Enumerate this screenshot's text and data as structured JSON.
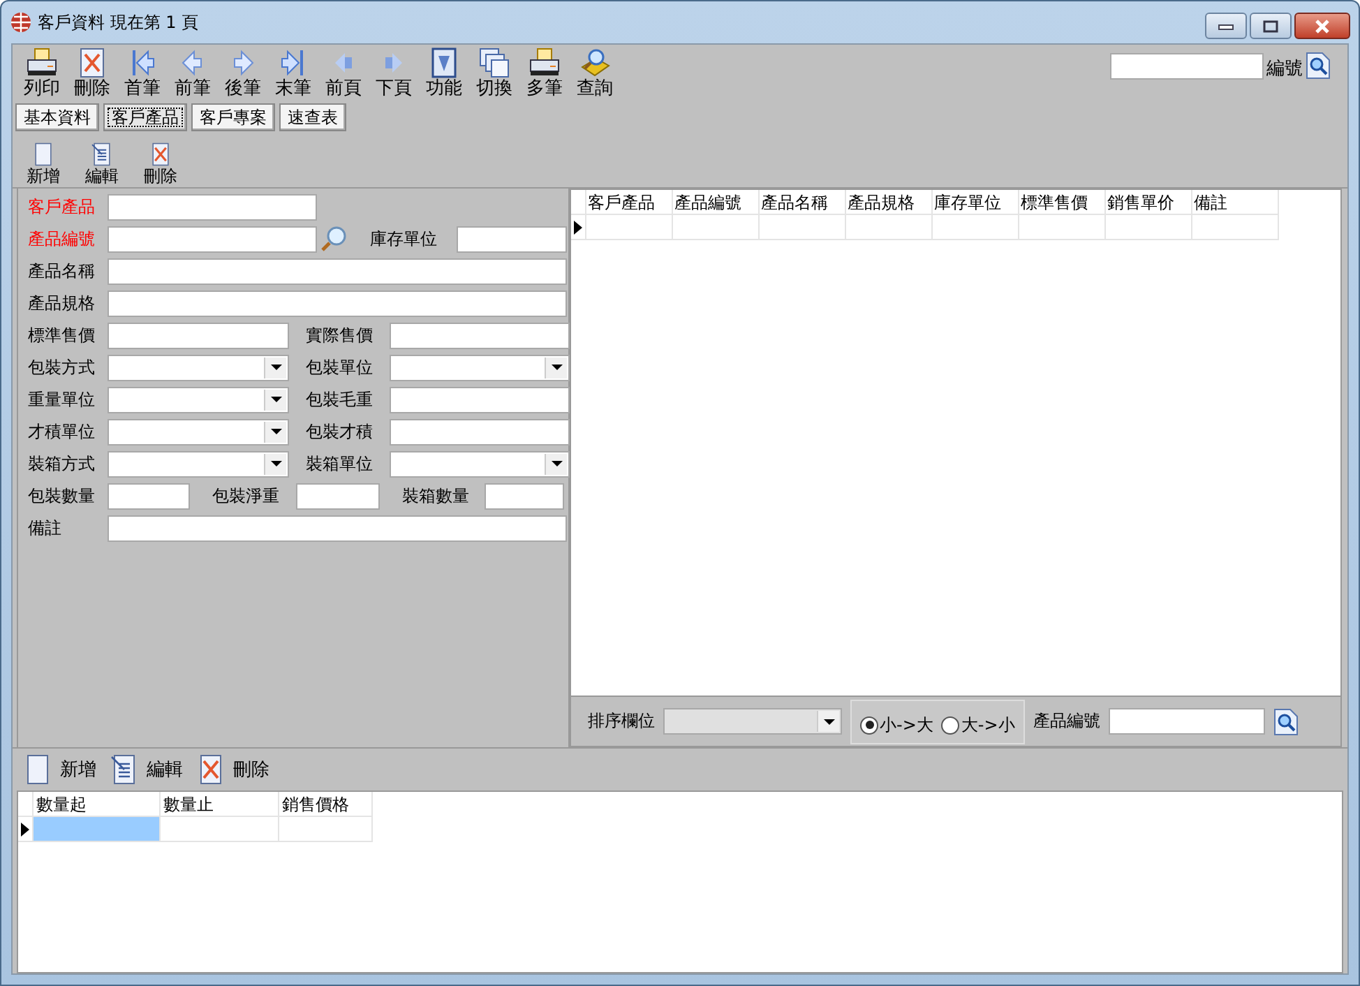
{
  "window": {
    "title": "客戶資料 現在第 1 頁"
  },
  "toolbar": [
    {
      "label": "列印"
    },
    {
      "label": "刪除"
    },
    {
      "label": "首筆"
    },
    {
      "label": "前筆"
    },
    {
      "label": "後筆"
    },
    {
      "label": "末筆"
    },
    {
      "label": "前頁"
    },
    {
      "label": "下頁"
    },
    {
      "label": "功能"
    },
    {
      "label": "切換"
    },
    {
      "label": "多筆"
    },
    {
      "label": "查詢"
    }
  ],
  "search": {
    "label": "編號"
  },
  "tabs": [
    {
      "label": "基本資料",
      "selected": false
    },
    {
      "label": "客戶產品",
      "selected": true
    },
    {
      "label": "客戶專案",
      "selected": false
    },
    {
      "label": "速查表",
      "selected": false
    }
  ],
  "subtoolbar": [
    {
      "label": "新增"
    },
    {
      "label": "編輯"
    },
    {
      "label": "刪除"
    }
  ],
  "form": {
    "rows": [
      {
        "fields": [
          {
            "label": "客戶產品",
            "required": true,
            "kind": "text"
          }
        ]
      },
      {
        "fields": [
          {
            "label": "產品編號",
            "required": true,
            "kind": "text"
          },
          {
            "label": "庫存單位",
            "required": false,
            "kind": "text"
          }
        ]
      },
      {
        "fields": [
          {
            "label": "產品名稱",
            "required": false,
            "kind": "text"
          }
        ]
      },
      {
        "fields": [
          {
            "label": "產品規格",
            "required": false,
            "kind": "text"
          }
        ]
      },
      {
        "fields": [
          {
            "label": "標準售價",
            "required": false,
            "kind": "text"
          },
          {
            "label": "實際售價",
            "required": false,
            "kind": "text"
          }
        ]
      },
      {
        "fields": [
          {
            "label": "包裝方式",
            "required": false,
            "kind": "combo"
          },
          {
            "label": "包裝單位",
            "required": false,
            "kind": "combo"
          }
        ]
      },
      {
        "fields": [
          {
            "label": "重量單位",
            "required": false,
            "kind": "combo"
          },
          {
            "label": "包裝毛重",
            "required": false,
            "kind": "text"
          }
        ]
      },
      {
        "fields": [
          {
            "label": "才積單位",
            "required": false,
            "kind": "combo"
          },
          {
            "label": "包裝才積",
            "required": false,
            "kind": "text"
          }
        ]
      },
      {
        "fields": [
          {
            "label": "裝箱方式",
            "required": false,
            "kind": "combo"
          },
          {
            "label": "裝箱單位",
            "required": false,
            "kind": "combo"
          }
        ]
      },
      {
        "fields": [
          {
            "label": "包裝數量",
            "required": false,
            "kind": "text"
          },
          {
            "label": "包裝淨重",
            "required": false,
            "kind": "text"
          },
          {
            "label": "裝箱數量",
            "required": false,
            "kind": "text"
          }
        ]
      },
      {
        "fields": [
          {
            "label": "備註",
            "required": false,
            "kind": "text"
          }
        ]
      }
    ]
  },
  "grid": {
    "columns": [
      "客戶產品",
      "產品編號",
      "產品名稱",
      "產品規格",
      "庫存單位",
      "標準售價",
      "銷售單价",
      "備註"
    ]
  },
  "sort": {
    "label": "排序欄位",
    "options": [
      {
        "label": "小->大",
        "selected": true
      },
      {
        "label": "大->小",
        "selected": false
      }
    ],
    "search_label": "產品編號"
  },
  "bottom_toolbar": [
    {
      "label": "新增"
    },
    {
      "label": "編輯"
    },
    {
      "label": "刪除"
    }
  ],
  "price_grid": {
    "columns": [
      "數量起",
      "數量止",
      "銷售價格"
    ],
    "rows": [
      {
        "cells": [
          {
            "selected": true
          },
          {
            "selected": false
          },
          {
            "selected": false
          }
        ]
      }
    ]
  }
}
